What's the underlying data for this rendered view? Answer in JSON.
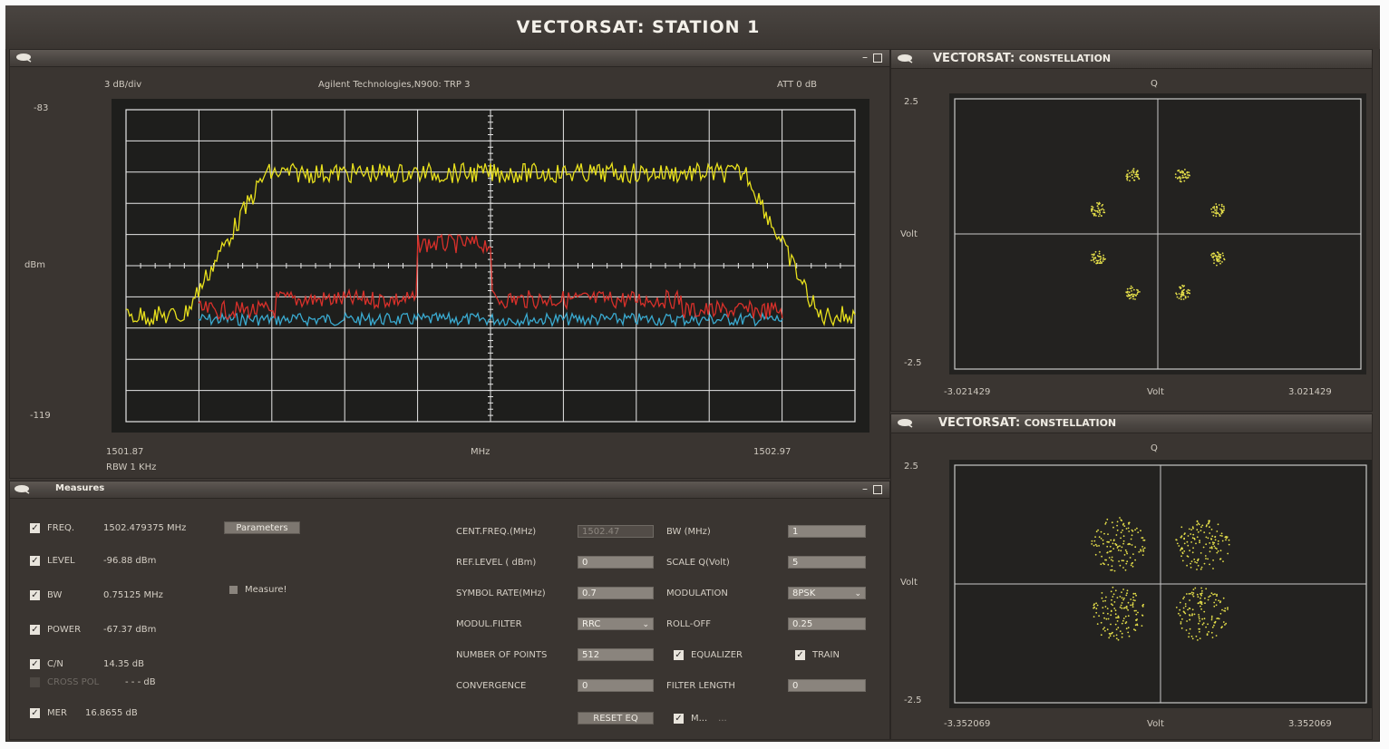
{
  "app": {
    "title": "VECTORSAT: STATION 1"
  },
  "spectrum": {
    "scale_label": "3 dB/div",
    "instrument": "Agilent Technologies,N900: TRP 3",
    "attenuation": "ATT 0 dB",
    "y_top": "-83",
    "y_unit": "dBm",
    "y_bottom": "-119",
    "x_start": "1501.87",
    "x_unit": "MHz",
    "x_end": "1502.97",
    "rbw": "RBW 1 KHz",
    "colors": {
      "trace_yellow": "#e8e01c",
      "trace_red": "#d8302a",
      "trace_cyan": "#3aaad0",
      "grid": "#e6e6e6"
    }
  },
  "constellation1": {
    "title_main": "VECTORSAT:",
    "title_sub": "CONSTELLATION",
    "q_label": "Q",
    "y_top": "2.5",
    "y_label": "Volt",
    "y_bottom": "-2.5",
    "x_left": "-3.021429",
    "x_label": "Volt",
    "x_right": "3.021429"
  },
  "constellation2": {
    "title_main": "VECTORSAT:",
    "title_sub": "CONSTELLATION",
    "q_label": "Q",
    "y_top": "2.5",
    "y_label": "Volt",
    "y_bottom": "-2.5",
    "x_left": "-3.352069",
    "x_label": "Volt",
    "x_right": "3.352069"
  },
  "measures": {
    "title": "Measures",
    "parameters_button": "Parameters",
    "measure_label": "Measure!",
    "items": {
      "freq": {
        "label": "FREQ.",
        "value": "1502.479375 MHz"
      },
      "level": {
        "label": "LEVEL",
        "value": "-96.88 dBm"
      },
      "bw": {
        "label": "BW",
        "value": "0.75125 MHz"
      },
      "power": {
        "label": "POWER",
        "value": "-67.37 dBm"
      },
      "cn": {
        "label": "C/N",
        "value": "14.35 dB"
      },
      "cross_pol": {
        "label": "CROSS POL",
        "value": "- - - dB"
      },
      "mer": {
        "label": "MER",
        "value": "16.8655 dB"
      }
    },
    "params": {
      "cent_freq": {
        "label": "CENT.FREQ.(MHz)",
        "value": "1502.47"
      },
      "bw": {
        "label": "BW (MHz)",
        "value": "1"
      },
      "ref_level": {
        "label": "REF.LEVEL ( dBm)",
        "value": "0"
      },
      "scale_q": {
        "label": "SCALE Q(Volt)",
        "value": "5"
      },
      "symbol_rate": {
        "label": "SYMBOL RATE(MHz)",
        "value": "0.7"
      },
      "modulation": {
        "label": "MODULATION",
        "value": "8PSK"
      },
      "modul_filter": {
        "label": "MODUL.FILTER",
        "value": "RRC"
      },
      "roll_off": {
        "label": "ROLL-OFF",
        "value": "0.25"
      },
      "num_points": {
        "label": "NUMBER OF POINTS",
        "value": "512"
      },
      "equalizer": {
        "label": "EQUALIZER"
      },
      "train": {
        "label": "TRAIN"
      },
      "convergence": {
        "label": "CONVERGENCE",
        "value": "0"
      },
      "filter_length": {
        "label": "FILTER LENGTH",
        "value": "0"
      },
      "reset_button": "RESET EQ",
      "m_label": "M...",
      "m_dots": "..."
    }
  },
  "icons": {
    "minimize": "–",
    "maximize": "□",
    "check": "✓",
    "caret": "⌄"
  }
}
